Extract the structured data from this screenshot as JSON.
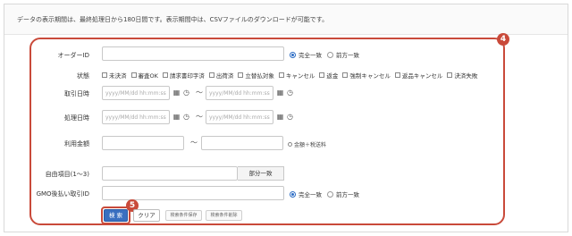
{
  "notice": "データの表示期間は、最終処理日から180日間です。表示期間中は、CSVファイルのダウンロードが可能です。",
  "callouts": {
    "search_form": "4",
    "search_button": "5"
  },
  "fields": {
    "order_id": {
      "label": "オーダーID",
      "value": ""
    },
    "status": {
      "label": "状態",
      "options": [
        "未決済",
        "審査OK",
        "請求書印字済",
        "出荷済",
        "立替払対象",
        "キャンセル",
        "返金",
        "強制キャンセル",
        "返品キャンセル",
        "決済失敗"
      ]
    },
    "transaction_datetime": {
      "label": "取引日時",
      "from_placeholder": "yyyy/MM/dd hh:mm:ss",
      "to_placeholder": "yyyy/MM/dd hh:mm:ss"
    },
    "processing_datetime": {
      "label": "処理日時",
      "from_placeholder": "yyyy/MM/dd hh:mm:ss",
      "to_placeholder": "yyyy/MM/dd hh:mm:ss"
    },
    "amount": {
      "label": "利用金額",
      "note": "金額＋税送料"
    },
    "free_item": {
      "label": "自由項目(1〜3)",
      "suffix": "部分一致"
    },
    "gmo_transaction_id": {
      "label": "GMO後払い取引ID"
    }
  },
  "match_options": {
    "exact": "完全一致",
    "prefix": "前方一致"
  },
  "range_separator": "〜",
  "buttons": {
    "search": "検 索",
    "clear": "クリア",
    "save_conditions": "検索条件保存",
    "delete_conditions": "検索条件削除"
  },
  "icons": {
    "calendar": "calendar-icon",
    "clock": "clock-icon"
  },
  "colors": {
    "callout": "#c94a3a",
    "primary": "#3a6fc0"
  }
}
